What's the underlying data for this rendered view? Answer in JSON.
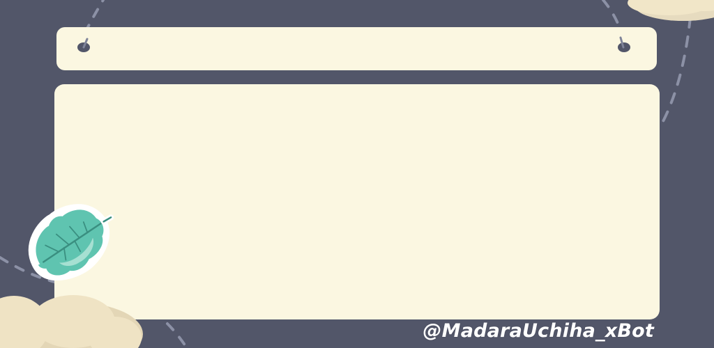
{
  "watermark": {
    "text": "@MadaraUchiha_xBot"
  },
  "colors": {
    "background": "#525669",
    "board": "#fbf7e1",
    "leaf": "#5fc4b0",
    "cloud": "#f1e6c8",
    "dash": "#8c91a6"
  },
  "decorations": {
    "leaf": "leaf-sticker",
    "clouds": [
      "cloud-top-right",
      "cloud-bottom-left"
    ]
  }
}
